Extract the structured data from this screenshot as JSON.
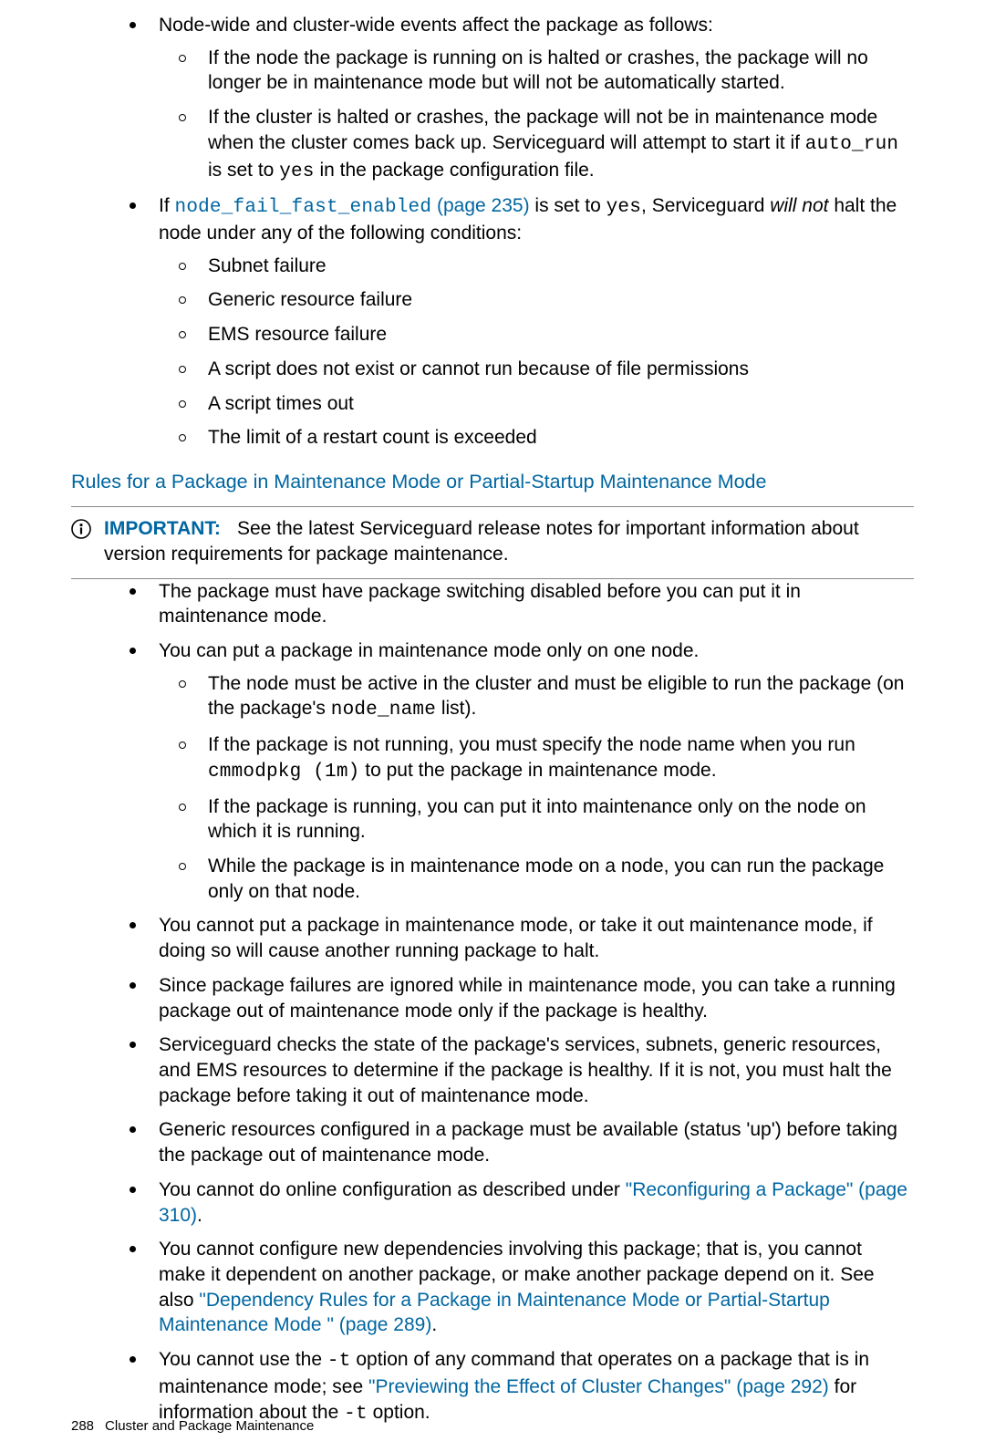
{
  "topList": {
    "item1": {
      "intro": "Node-wide and cluster-wide events affect the package as follows:",
      "sub1": "If the node the package is running on is halted or crashes, the package will no longer be in maintenance mode but will not be automatically started.",
      "sub2_a": "If the cluster is halted or crashes, the package will not be in maintenance mode when the cluster comes back up. Serviceguard will attempt to start it if ",
      "sub2_code1": "auto_run",
      "sub2_b": " is set to ",
      "sub2_code2": "yes",
      "sub2_c": " in the package configuration file."
    },
    "item2": {
      "a": "If ",
      "link_code": "node_fail_fast_enabled",
      "link_rest": " (page 235)",
      "b": " is set to ",
      "code_yes": "yes",
      "c": ", Serviceguard ",
      "em": "will not",
      "d": " halt the node under any of the following conditions:",
      "sub1": "Subnet failure",
      "sub2": "Generic resource failure",
      "sub3": "EMS resource failure",
      "sub4": "A script does not exist or cannot run because of file permissions",
      "sub5": "A script times out",
      "sub6": "The limit of a restart count is exceeded"
    }
  },
  "sectionHeading": "Rules for a Package in Maintenance Mode or Partial-Startup Maintenance Mode",
  "important": {
    "label": "IMPORTANT:",
    "text": "See the latest Serviceguard release notes for important information about version requirements for package maintenance."
  },
  "rules": {
    "r1": "The package must have package switching disabled before you can put it in maintenance mode.",
    "r2": {
      "intro": "You can put a package in maintenance mode only on one node.",
      "s1a": "The node must be active in the cluster and must be eligible to run the package (on the package's ",
      "s1code": "node_name",
      "s1b": " list).",
      "s2a": "If the package is not running, you must specify the node name when you run ",
      "s2code": "cmmodpkg (1m)",
      "s2b": " to put the package in maintenance mode.",
      "s3": "If the package is running, you can put it into maintenance only on the node on which it is running.",
      "s4": "While the package is in maintenance mode on a node, you can run the package only on that node."
    },
    "r3": "You cannot put a package in maintenance mode, or take it out maintenance mode, if doing so will cause another running package to halt.",
    "r4": "Since package failures are ignored while in maintenance mode, you can take a running package out of maintenance mode only if the package is healthy.",
    "r5": "Serviceguard checks the state of the package's services, subnets, generic resources, and EMS resources to determine if the package is healthy. If it is not, you must halt the package before taking it out of maintenance mode.",
    "r6": "Generic resources configured in a package must be available (status 'up') before taking the package out of maintenance mode.",
    "r7a": "You cannot do online configuration as described under ",
    "r7link": "\"Reconfiguring a Package\" (page 310)",
    "r7b": ".",
    "r8a": "You cannot configure new dependencies involving this package; that is, you cannot make it dependent on another package, or make another package depend on it. See also ",
    "r8link": "\"Dependency Rules for a Package in Maintenance Mode or Partial-Startup Maintenance Mode \" (page 289)",
    "r8b": ".",
    "r9a": "You cannot use the ",
    "r9code1": "-t",
    "r9b": " option of any command that operates on a package that is in maintenance mode; see ",
    "r9link": "\"Previewing the Effect of Cluster Changes\" (page 292)",
    "r9c": " for information about the ",
    "r9code2": "-t",
    "r9d": " option."
  },
  "footer": {
    "pagenum": "288",
    "title": "Cluster and Package Maintenance"
  }
}
